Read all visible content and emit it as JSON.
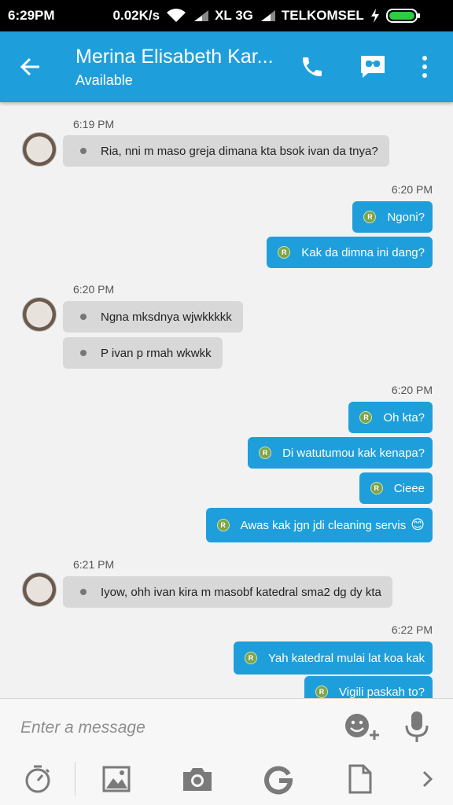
{
  "status_bar": {
    "time": "6:29PM",
    "speed": "0.02K/s",
    "network_1": "XL 3G",
    "network_2": "TELKOMSEL"
  },
  "header": {
    "title": "Merina Elisabeth Kar...",
    "subtitle": "Available"
  },
  "messages": [
    {
      "type": "timestamp",
      "side": "in",
      "text": "6:19 PM"
    },
    {
      "type": "msg",
      "side": "in",
      "text": "Ria, nni m maso greja dimana kta bsok ivan da tnya?",
      "avatar": true
    },
    {
      "type": "timestamp",
      "side": "out",
      "text": "6:20 PM"
    },
    {
      "type": "msg",
      "side": "out",
      "text": "Ngoni?"
    },
    {
      "type": "msg",
      "side": "out",
      "text": "Kak da dimna ini dang?"
    },
    {
      "type": "timestamp",
      "side": "in",
      "text": "6:20 PM"
    },
    {
      "type": "msg",
      "side": "in",
      "text": "Ngna mksdnya wjwkkkkk",
      "avatar": true
    },
    {
      "type": "msg",
      "side": "in",
      "text": "P ivan p rmah wkwkk"
    },
    {
      "type": "timestamp",
      "side": "out",
      "text": "6:20 PM"
    },
    {
      "type": "msg",
      "side": "out",
      "text": "Oh kta?"
    },
    {
      "type": "msg",
      "side": "out",
      "text": "Di watutumou kak kenapa?"
    },
    {
      "type": "msg",
      "side": "out",
      "text": "Cieee"
    },
    {
      "type": "msg",
      "side": "out",
      "text": "Awas kak jgn jdi cleaning servis",
      "emoji": "😊"
    },
    {
      "type": "timestamp",
      "side": "in",
      "text": "6:21 PM"
    },
    {
      "type": "msg",
      "side": "in",
      "text": "Iyow, ohh ivan kira m masobf katedral sma2 dg dy kta",
      "avatar": true
    },
    {
      "type": "timestamp",
      "side": "out",
      "text": "6:22 PM"
    },
    {
      "type": "msg",
      "side": "out",
      "text": "Yah katedral mulai lat koa kak"
    },
    {
      "type": "msg",
      "side": "out",
      "text": "Vigili paskah to?"
    }
  ],
  "sender_badge": "R",
  "composer": {
    "placeholder": "Enter a message"
  },
  "toolbar_icons": [
    "timer-icon",
    "gallery-icon",
    "camera-icon",
    "gif-icon",
    "file-icon",
    "chevron-right-icon"
  ],
  "colors": {
    "accent": "#1e9fdb",
    "incoming_bubble": "#d8d8d8",
    "badge": "#7fa34a"
  }
}
